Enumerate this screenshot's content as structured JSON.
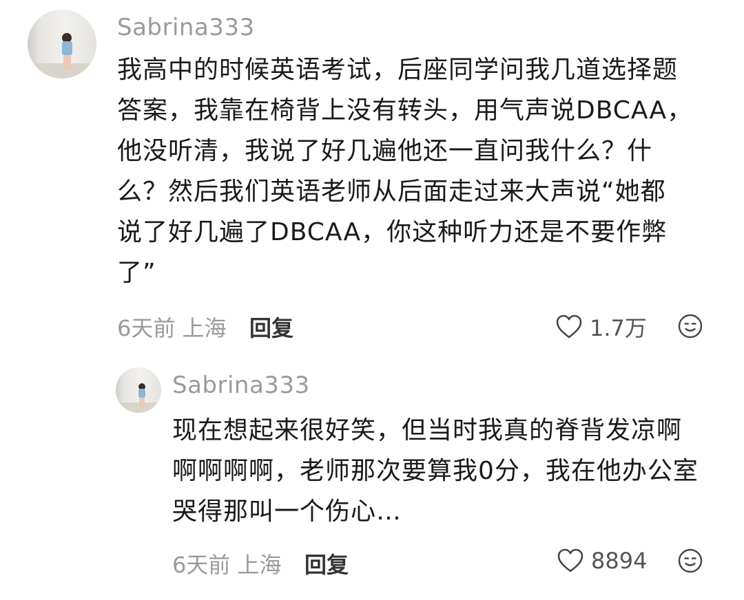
{
  "comments": [
    {
      "username": "Sabrina333",
      "text": "我高中的时候英语考试，后座同学问我几道选择题\n答案，我靠在椅背上没有转头，用气声说DBCAA，\n他没听清，我说了好几遍他还一直问我什么？什\n么？然后我们英语老师从后面走过来大声说“她都\n说了好几遍了DBCAA，你这种听力还是不要作弊\n了”",
      "time": "6天前",
      "location": "上海",
      "reply_label": "回复",
      "likes": "1.7万"
    },
    {
      "username": "Sabrina333",
      "text": "现在想起来很好笑，但当时我真的脊背发凉啊\n啊啊啊啊，老师那次要算我0分，我在他办公室\n哭得那叫一个伤心…",
      "time": "6天前",
      "location": "上海",
      "reply_label": "回复",
      "likes": "8894"
    }
  ],
  "icons": {
    "like": "heart-outline-icon",
    "emoji": "smiley-face-icon"
  }
}
